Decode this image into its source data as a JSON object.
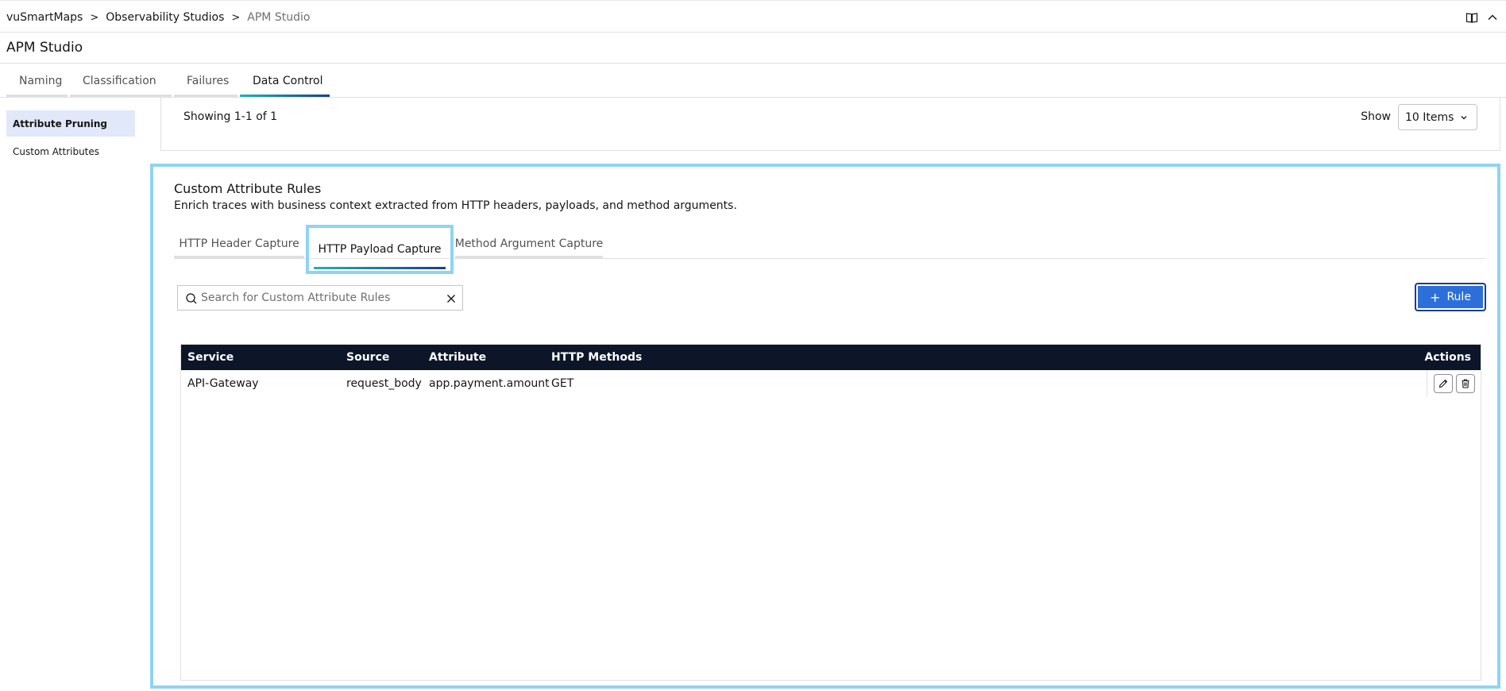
{
  "breadcrumb": {
    "items": [
      "vuSmartMaps",
      "Observability Studios",
      "APM Studio"
    ],
    "separator": ">"
  },
  "page": {
    "title": "APM Studio"
  },
  "top_icons": [
    "book-icon",
    "chevron-up-icon"
  ],
  "main_tabs": [
    "Naming",
    "Classification",
    "Failures",
    "Data Control"
  ],
  "active_main_tab": "Data Control",
  "sidebar": {
    "items": [
      "Attribute Pruning",
      "Custom Attributes"
    ],
    "active": "Attribute Pruning"
  },
  "pager": {
    "showing": "Showing 1-1 of 1",
    "show_label": "Show",
    "page_size": "10 Items"
  },
  "card": {
    "title": "Custom Attribute Rules",
    "description": "Enrich traces with business context extracted from HTTP headers, payloads, and method arguments."
  },
  "sub_tabs": [
    "HTTP Header Capture",
    "HTTP Payload Capture",
    "Method Argument Capture"
  ],
  "active_sub_tab": "HTTP Payload Capture",
  "search": {
    "placeholder": "Search for Custom Attribute Rules",
    "value": ""
  },
  "rule_button": {
    "label": "Rule"
  },
  "table": {
    "columns": [
      "Service",
      "Source",
      "Attribute",
      "HTTP Methods",
      "Actions"
    ],
    "rows": [
      {
        "service": "API-Gateway",
        "source": "request_body",
        "attribute": "app.payment.amount",
        "methods": "GET"
      }
    ]
  },
  "colors": {
    "accent_blue": "#2d6fd9",
    "highlight": "#8fd3f4",
    "table_header": "#0d1529",
    "tab_gradient_start": "#1fb5b8",
    "tab_gradient_end": "#1b3d8f"
  }
}
